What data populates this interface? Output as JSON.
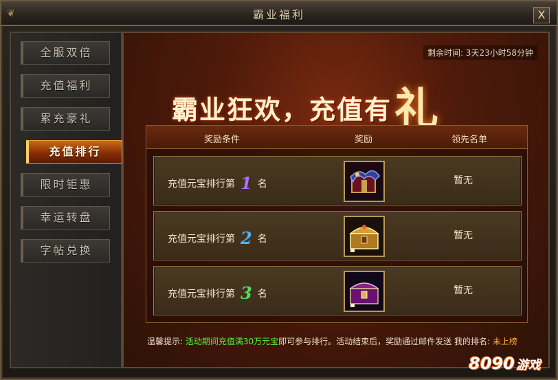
{
  "window": {
    "title": "霸业福利",
    "close_label": "X"
  },
  "sidebar": {
    "items": [
      {
        "label": "全服双倍",
        "active": false
      },
      {
        "label": "充值福利",
        "active": false
      },
      {
        "label": "累充豪礼",
        "active": false
      },
      {
        "label": "充值排行",
        "active": true
      },
      {
        "label": "限时钜惠",
        "active": false
      },
      {
        "label": "幸运转盘",
        "active": false
      },
      {
        "label": "字帖兑换",
        "active": false
      }
    ]
  },
  "main": {
    "remaining_time": "剩余时间: 3天23小时58分钟",
    "banner": {
      "text": "霸业狂欢，充值有",
      "big_char": "礼"
    },
    "table": {
      "headers": [
        "奖励条件",
        "奖励",
        "领先名单"
      ],
      "rows": [
        {
          "label": "充值元宝排行第",
          "rank": "1",
          "suffix": "名",
          "reward_icon": "dragon-gift-box-icon",
          "leader": "暂无",
          "rank_color": "#b070ff"
        },
        {
          "label": "充值元宝排行第",
          "rank": "2",
          "suffix": "名",
          "reward_icon": "golden-treasure-chest-icon",
          "leader": "暂无",
          "rank_color": "#50b0ff"
        },
        {
          "label": "充值元宝排行第",
          "rank": "3",
          "suffix": "名",
          "reward_icon": "purple-treasure-chest-icon",
          "leader": "暂无",
          "rank_color": "#50e060"
        }
      ]
    },
    "tip": {
      "prefix": "温馨提示: ",
      "highlight": "活动期间充值满30万元宝",
      "middle": "即可参与排行。活动结束后，奖励通过邮件发送   我的排名: ",
      "rank_value": "未上榜"
    }
  },
  "watermark": {
    "number": "8090",
    "text": "游戏"
  }
}
